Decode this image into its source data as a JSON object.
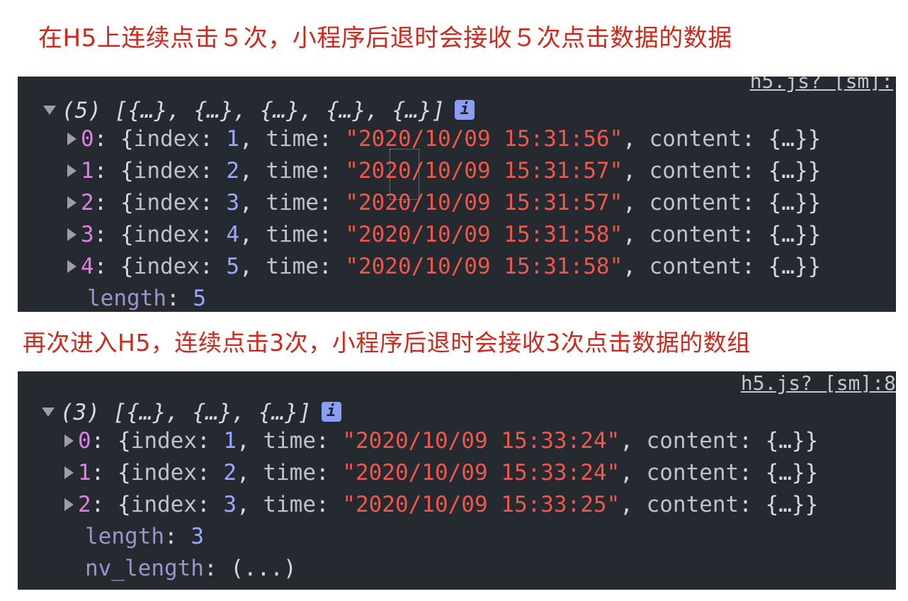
{
  "caption1": "在H5上连续点击５次，小程序后退时会接收５次点击数据的数据",
  "caption2": "再次进入H5，连续点击3次，小程序后退时会接收3次点击数据的数组",
  "panel1": {
    "source_link": "h5.js? [sm]:",
    "summary": "(5) [{…}, {…}, {…}, {…}, {…}]",
    "info_icon": "i",
    "rows": [
      {
        "idx": "0",
        "index": "1",
        "time": "\"2020/10/09 15:31:56\"",
        "content": "{…}"
      },
      {
        "idx": "1",
        "index": "2",
        "time": "\"2020/10/09 15:31:57\"",
        "content": "{…}"
      },
      {
        "idx": "2",
        "index": "3",
        "time": "\"2020/10/09 15:31:57\"",
        "content": "{…}"
      },
      {
        "idx": "3",
        "index": "4",
        "time": "\"2020/10/09 15:31:58\"",
        "content": "{…}"
      },
      {
        "idx": "4",
        "index": "5",
        "time": "\"2020/10/09 15:31:58\"",
        "content": "{…}"
      }
    ],
    "length_key": "length",
    "length_value": "5"
  },
  "panel2": {
    "source_link": "h5.js? [sm]:8",
    "summary": "(3) [{…}, {…}, {…}]",
    "info_icon": "i",
    "rows": [
      {
        "idx": "0",
        "index": "1",
        "time": "\"2020/10/09 15:33:24\"",
        "content": "{…}"
      },
      {
        "idx": "1",
        "index": "2",
        "time": "\"2020/10/09 15:33:24\"",
        "content": "{…}"
      },
      {
        "idx": "2",
        "index": "3",
        "time": "\"2020/10/09 15:33:25\"",
        "content": "{…}"
      }
    ],
    "length_key": "length",
    "length_value": "3",
    "nv_length_key": "nv_length",
    "nv_length_value": "(...)"
  },
  "labels": {
    "index": "index",
    "time": "time",
    "content": "content"
  },
  "colors": {
    "caption": "#d0281c",
    "panel_bg": "#252a31",
    "string": "#f0574b",
    "number": "#9ba6ff",
    "array_index": "#e27ee6",
    "info_badge": "#8c9df5"
  }
}
